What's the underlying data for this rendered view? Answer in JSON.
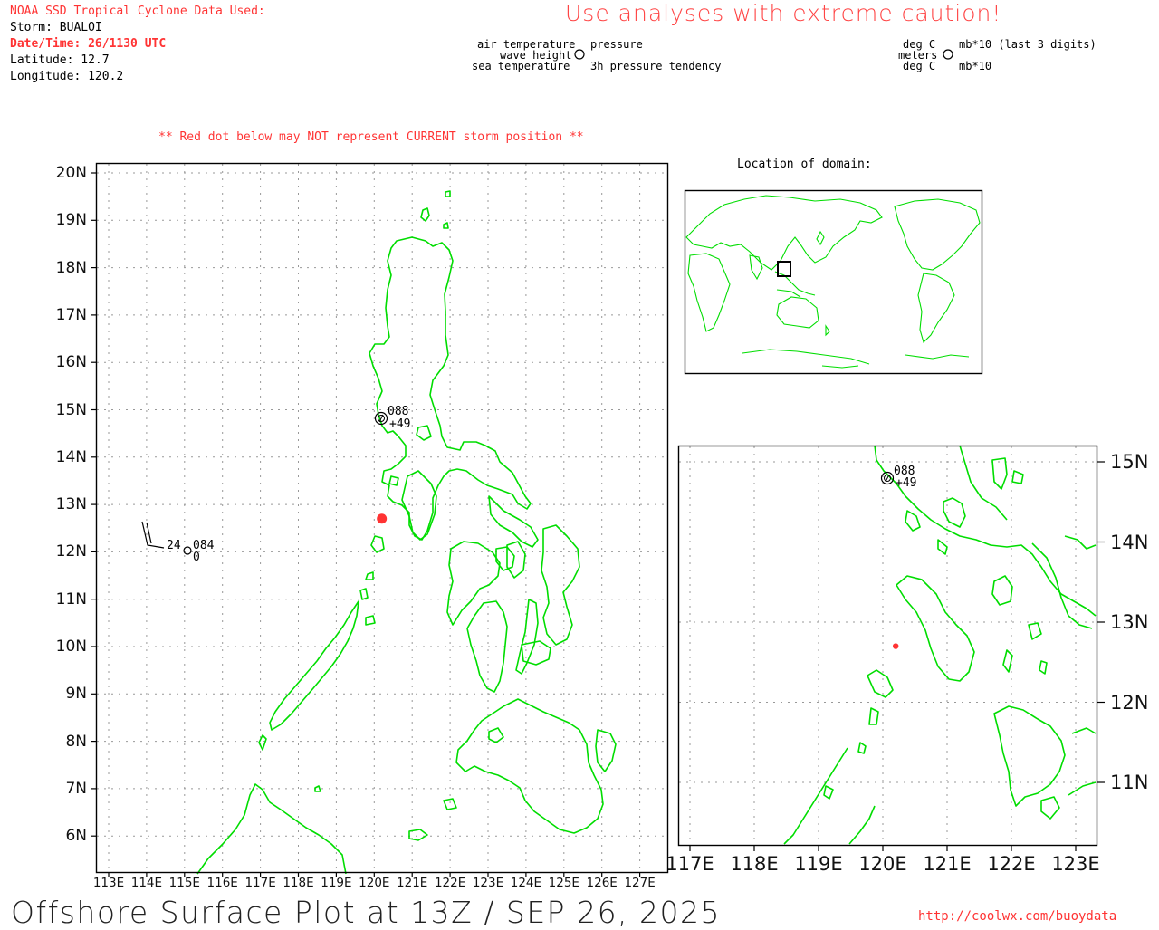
{
  "header": {
    "source_label": "NOAA SSD Tropical Cyclone Data Used:",
    "storm": "Storm: BUALOI",
    "datetime": "Date/Time: 26/1130 UTC",
    "latitude": "Latitude: 12.7",
    "longitude": "Longitude: 120.2",
    "caution": "Use analyses with extreme caution!"
  },
  "legend_left": {
    "air_temperature": "air temperature",
    "wave_height": "wave height",
    "sea_temperature": "sea temperature",
    "pressure": "pressure",
    "pressure_tendency": "3h pressure tendency"
  },
  "legend_right": {
    "deg_c_top": "deg C",
    "meters": "meters",
    "deg_c_bottom": "deg C",
    "mb_last3": "mb*10 (last 3 digits)",
    "mb10": "mb*10"
  },
  "red_dot_note": "** Red dot below may NOT represent CURRENT storm position **",
  "inset_title": "Location of domain:",
  "main_map": {
    "lat_labels": [
      "20N",
      "19N",
      "18N",
      "17N",
      "16N",
      "15N",
      "14N",
      "13N",
      "12N",
      "11N",
      "10N",
      "9N",
      "8N",
      "7N",
      "6N"
    ],
    "lon_labels": [
      "113E",
      "114E",
      "115E",
      "116E",
      "117E",
      "118E",
      "119E",
      "120E",
      "121E",
      "122E",
      "123E",
      "124E",
      "125E",
      "126E",
      "127E"
    ],
    "station1": {
      "pressure": "088",
      "tendency": "+49"
    },
    "station2": {
      "air_temp": "24",
      "pressure": "084",
      "wave": "0"
    }
  },
  "zoom_map": {
    "lat_labels": [
      "15N",
      "14N",
      "13N",
      "12N",
      "11N"
    ],
    "lon_labels": [
      "117E",
      "118E",
      "119E",
      "120E",
      "121E",
      "122E",
      "123E"
    ],
    "station1": {
      "pressure": "088",
      "tendency": "+49"
    }
  },
  "storm_position": {
    "lat": 12.7,
    "lon": 120.2
  },
  "colors": {
    "land": "#00dd00",
    "accent": "#ff3333",
    "storm_dot": "#ff3333"
  },
  "footer": {
    "title": "Offshore Surface Plot at 13Z / SEP 26, 2025",
    "url": "http://coolwx.com/buoydata"
  }
}
